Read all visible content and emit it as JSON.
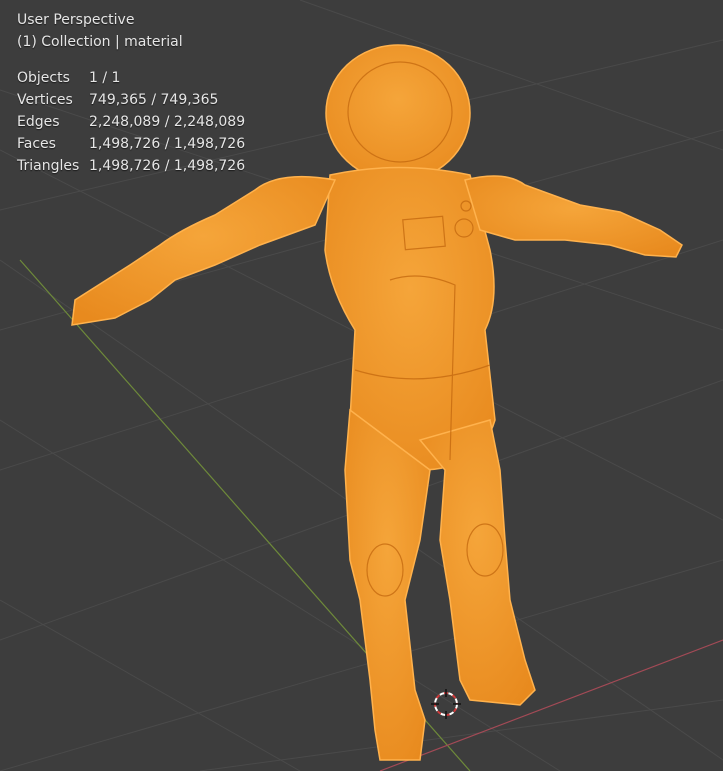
{
  "viewport": {
    "view_name": "User Perspective",
    "collection_prefix": "(1) Collection",
    "separator": "|",
    "object_name": "material",
    "colors": {
      "background": "#3d3d3d",
      "grid": "#4a4a4a",
      "axis_x": "#a34a56",
      "axis_y": "#6e8a3a",
      "model": "#f39a2b"
    }
  },
  "stats": [
    {
      "label": "Objects",
      "value": "1 / 1"
    },
    {
      "label": "Vertices",
      "value": "749,365 / 749,365"
    },
    {
      "label": "Edges",
      "value": "2,248,089 / 2,248,089"
    },
    {
      "label": "Faces",
      "value": "1,498,726 / 1,498,726"
    },
    {
      "label": "Triangles",
      "value": "1,498,726 / 1,498,726"
    }
  ],
  "icons": {
    "cursor": "3d-cursor-icon"
  }
}
